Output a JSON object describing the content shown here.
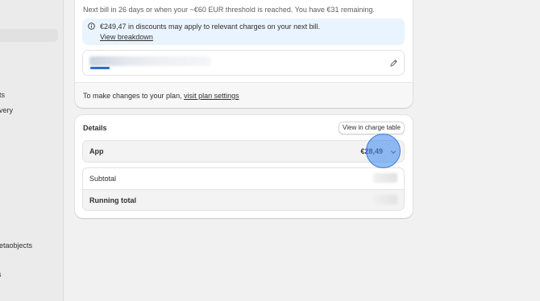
{
  "sidebar": {
    "items": [
      {
        "label": "ts"
      },
      {
        "label": "very"
      },
      {
        "label": "etaobjects"
      },
      {
        "label": "s"
      }
    ]
  },
  "billing": {
    "next_bill_text": "Next bill in 26 days or when your ~€60 EUR threshold is reached. You have €31 remaining.",
    "banner": {
      "text": "€249,47 in discounts may apply to relevant charges on your next bill.",
      "link": "View breakdown"
    },
    "footer": {
      "prefix": "To make changes to your plan, ",
      "link": "visit plan settings"
    }
  },
  "details": {
    "title": "Details",
    "view_button": "View in charge table",
    "app": {
      "label": "App",
      "amount": "€28,49"
    },
    "subtotal_label": "Subtotal",
    "running_total_label": "Running total"
  },
  "colors": {
    "accent": "#2c6ecb",
    "banner_bg": "#eaf4ff",
    "click_indicator": "#4a90f0"
  },
  "icons": {
    "info": "info-icon",
    "edit": "pencil-icon",
    "expand": "chevron-down-icon"
  }
}
